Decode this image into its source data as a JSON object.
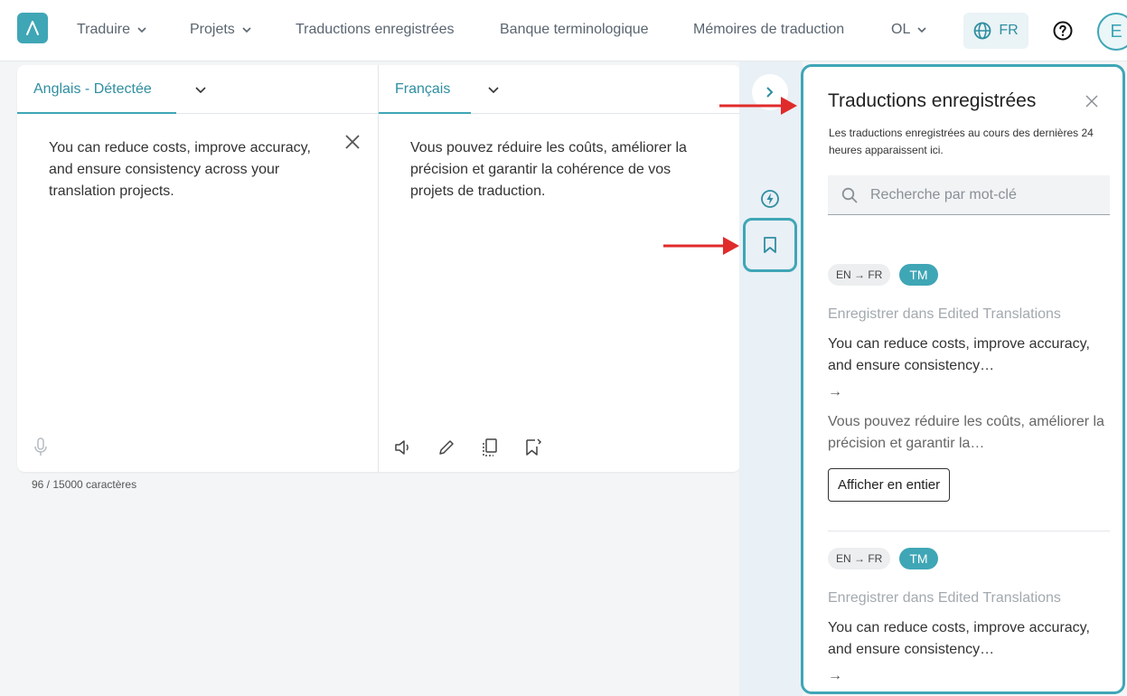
{
  "nav": {
    "items": [
      {
        "label": "Traduire",
        "dropdown": true
      },
      {
        "label": "Projets",
        "dropdown": true
      },
      {
        "label": "Traductions enregistrées",
        "dropdown": false
      },
      {
        "label": "Banque terminologique",
        "dropdown": false
      },
      {
        "label": "Mémoires de traduction",
        "dropdown": false
      },
      {
        "label": "OL",
        "dropdown": true
      }
    ],
    "language": "FR",
    "avatar_initial": "E"
  },
  "source": {
    "language_tab": "Anglais - Détectée",
    "text": "You can reduce costs, improve accuracy, and ensure consistency across your translation projects.",
    "char_count": "96 / 15000 caractères"
  },
  "target": {
    "language_tab": "Français",
    "text": "Vous pouvez réduire les coûts, améliorer la précision et garantir la cohérence de vos projets de traduction."
  },
  "sidebar": {
    "title": "Traductions enregistrées",
    "description": "Les traductions enregistrées au cours des dernières 24 heures apparaissent ici.",
    "search_placeholder": "Recherche par mot-clé",
    "entries": [
      {
        "lang_pair": "EN → FR",
        "badge": "TM",
        "save_label": "Enregistrer dans Edited Translations",
        "source_preview": "You can reduce costs, improve accuracy, and ensure consistency…",
        "arrow": "→",
        "target_preview": "Vous pouvez réduire les coûts, améliorer la précision et garantir la…",
        "show_button": "Afficher en entier"
      },
      {
        "lang_pair": "EN → FR",
        "badge": "TM",
        "save_label": "Enregistrer dans Edited Translations",
        "source_preview": "You can reduce costs, improve accuracy, and ensure consistency…",
        "arrow": "→"
      }
    ]
  },
  "colors": {
    "accent": "#3fa6b6",
    "annotation_arrow": "#e02b2b"
  },
  "icons": [
    "logo-icon",
    "chevron-down-icon",
    "globe-icon",
    "help-icon",
    "close-icon",
    "microphone-icon",
    "speaker-icon",
    "pencil-icon",
    "copy-icon",
    "bookmark-edit-icon",
    "chevron-right-icon",
    "bolt-icon",
    "bookmark-icon",
    "search-icon"
  ]
}
